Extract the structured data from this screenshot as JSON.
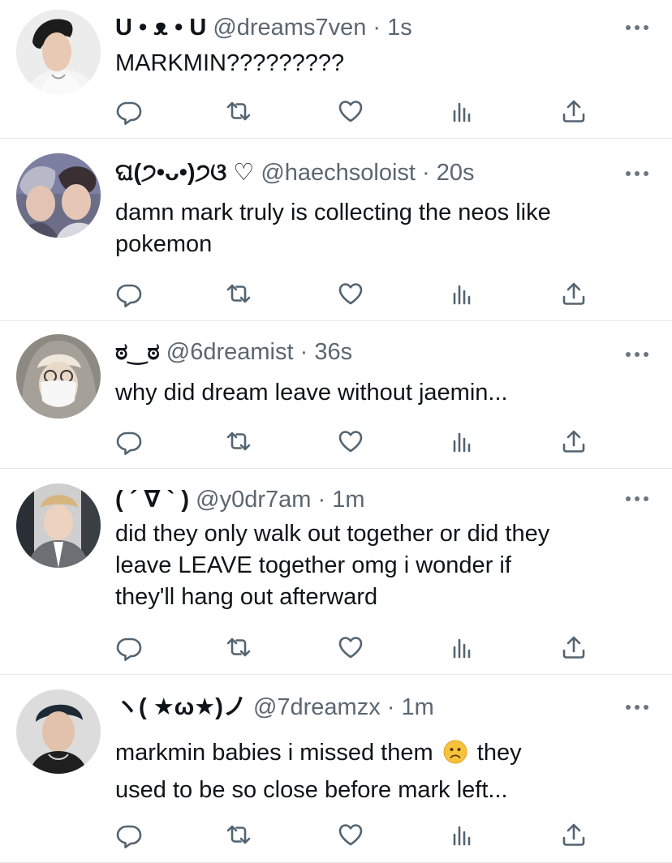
{
  "tweets": [
    {
      "name": "U • ᴥ • U",
      "handle": "@dreams7ven",
      "separator": "·",
      "time": "1s",
      "lines": [
        "MARKMIN?????????"
      ]
    },
    {
      "name": "ଘ(੭•ᴗ•)੭ଓ ♡",
      "handle": "@haechsoloist",
      "separator": "·",
      "time": "20s",
      "lines": [
        "damn mark truly is collecting the neos like",
        "pokemon"
      ]
    },
    {
      "name": "ಠ‿ಠ",
      "handle": "@6dreamist",
      "separator": "·",
      "time": "36s",
      "lines": [
        "why did dream leave without jaemin..."
      ]
    },
    {
      "name": "( ´ ∇ ` )",
      "handle": "@y0dr7am",
      "separator": "·",
      "time": "1m",
      "lines": [
        "did they only walk out together or did they",
        "leave LEAVE together omg i wonder if",
        "they'll hang out afterward"
      ]
    },
    {
      "name": "ヽ( ★ω★)ノ",
      "handle": "@7dreamzx",
      "separator": "·",
      "time": "1m",
      "line1_before": "markmin babies i missed them",
      "line1_emoji": "slightly-frowning-face-emoji",
      "line1_after": "they",
      "line2": "used to be so close before mark left..."
    }
  ],
  "icons": {
    "reply": "reply-icon",
    "retweet": "retweet-icon",
    "like": "like-icon",
    "analytics": "analytics-icon",
    "share": "share-icon",
    "more": "more-icon"
  },
  "colors": {
    "text": "#0f1419",
    "secondary": "#5b6670",
    "divider": "#e6e6e6",
    "icon": "#536471"
  }
}
